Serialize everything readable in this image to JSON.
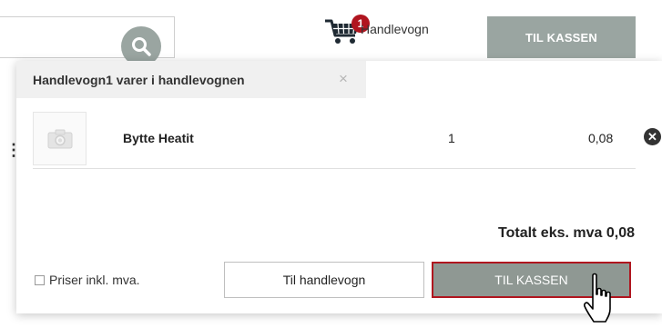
{
  "header": {
    "cart": {
      "badge_count": "1",
      "label": "Handlevogn"
    },
    "checkout_label": "TIL KASSEN",
    "icons": {
      "search": "search-icon",
      "cart": "shopping-cart-icon"
    }
  },
  "popup": {
    "title": "Handlevogn1 varer i handlevognen",
    "close_glyph": "×",
    "items": [
      {
        "name": "Bytte Heatit",
        "quantity": "1",
        "price": "0,08",
        "remove_glyph": "✕"
      }
    ],
    "total": "Totalt eks. mva 0,08",
    "vat_toggle_label": "Priser inkl. mva.",
    "vat_toggle_checked": false,
    "view_cart_label": "Til handlevogn",
    "checkout_label": "TIL KASSEN"
  },
  "colors": {
    "button_gray": "#9aa5a1",
    "badge_red": "#b0151f",
    "checkout_border": "#b0151f"
  }
}
